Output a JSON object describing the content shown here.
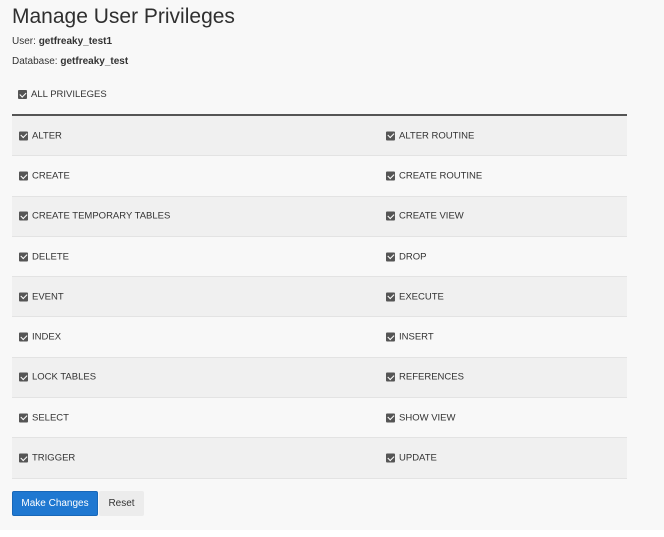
{
  "page": {
    "title": "Manage User Privileges",
    "user_label": "User:",
    "user_value": "getfreaky_test1",
    "database_label": "Database:",
    "database_value": "getfreaky_test"
  },
  "all_privileges": {
    "label": "ALL PRIVILEGES",
    "checked": true
  },
  "privileges": [
    {
      "left": "ALTER",
      "right": "ALTER ROUTINE"
    },
    {
      "left": "CREATE",
      "right": "CREATE ROUTINE"
    },
    {
      "left": "CREATE TEMPORARY TABLES",
      "right": "CREATE VIEW"
    },
    {
      "left": "DELETE",
      "right": "DROP"
    },
    {
      "left": "EVENT",
      "right": "EXECUTE"
    },
    {
      "left": "INDEX",
      "right": "INSERT"
    },
    {
      "left": "LOCK TABLES",
      "right": "REFERENCES"
    },
    {
      "left": "SELECT",
      "right": "SHOW VIEW"
    },
    {
      "left": "TRIGGER",
      "right": "UPDATE"
    }
  ],
  "buttons": {
    "make_changes": "Make Changes",
    "reset": "Reset"
  },
  "colors": {
    "primary": "#1f78d1",
    "checkbox": "#555555"
  }
}
